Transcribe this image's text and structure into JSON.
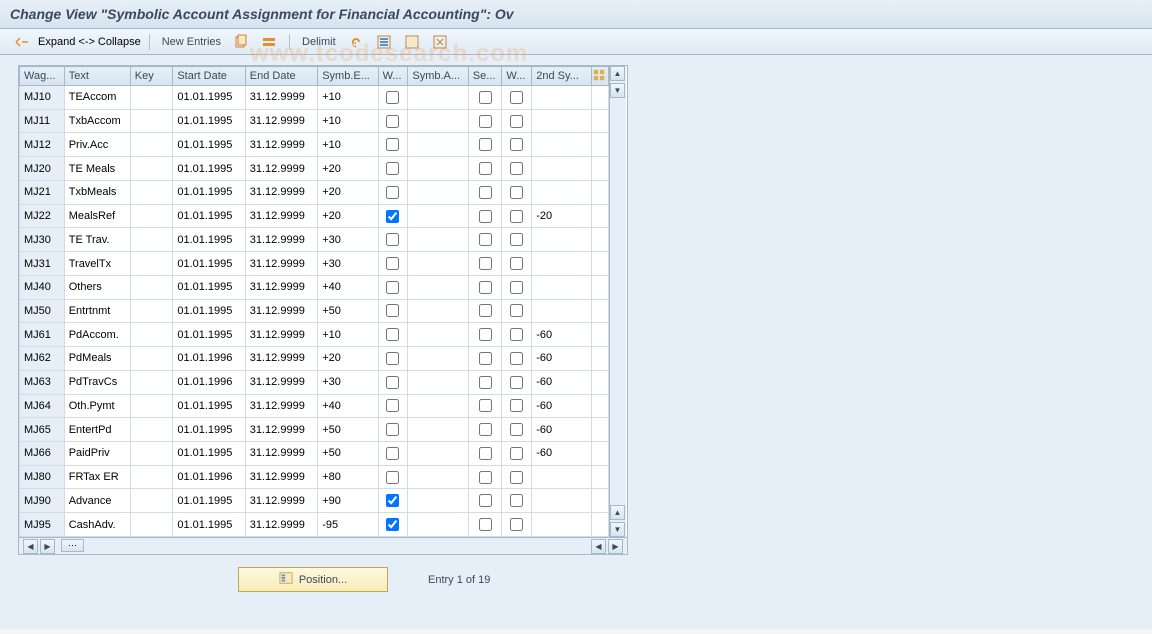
{
  "header": {
    "title": "Change View \"Symbolic Account Assignment for Financial Accounting\": Ov"
  },
  "toolbar": {
    "expand_collapse_label": "Expand <-> Collapse",
    "new_entries_label": "New Entries",
    "delimit_label": "Delimit"
  },
  "table": {
    "headers": {
      "wag": "Wag...",
      "text": "Text",
      "key": "Key",
      "start_date": "Start Date",
      "end_date": "End Date",
      "symb_e": "Symb.E...",
      "w1": "W...",
      "symb_a": "Symb.A...",
      "se": "Se...",
      "w2": "W...",
      "second_sy": "2nd Sy..."
    },
    "rows": [
      {
        "wag": "MJ10",
        "text": "TEAccom",
        "key": "",
        "start": "01.01.1995",
        "end": "31.12.9999",
        "symbe": "+10",
        "w1": false,
        "symba": "",
        "se": false,
        "w2": false,
        "sy2": ""
      },
      {
        "wag": "MJ11",
        "text": "TxbAccom",
        "key": "",
        "start": "01.01.1995",
        "end": "31.12.9999",
        "symbe": "+10",
        "w1": false,
        "symba": "",
        "se": false,
        "w2": false,
        "sy2": ""
      },
      {
        "wag": "MJ12",
        "text": "Priv.Acc",
        "key": "",
        "start": "01.01.1995",
        "end": "31.12.9999",
        "symbe": "+10",
        "w1": false,
        "symba": "",
        "se": false,
        "w2": false,
        "sy2": ""
      },
      {
        "wag": "MJ20",
        "text": "TE Meals",
        "key": "",
        "start": "01.01.1995",
        "end": "31.12.9999",
        "symbe": "+20",
        "w1": false,
        "symba": "",
        "se": false,
        "w2": false,
        "sy2": ""
      },
      {
        "wag": "MJ21",
        "text": "TxbMeals",
        "key": "",
        "start": "01.01.1995",
        "end": "31.12.9999",
        "symbe": "+20",
        "w1": false,
        "symba": "",
        "se": false,
        "w2": false,
        "sy2": ""
      },
      {
        "wag": "MJ22",
        "text": "MealsRef",
        "key": "",
        "start": "01.01.1995",
        "end": "31.12.9999",
        "symbe": "+20",
        "w1": true,
        "symba": "",
        "se": false,
        "w2": false,
        "sy2": "-20"
      },
      {
        "wag": "MJ30",
        "text": "TE Trav.",
        "key": "",
        "start": "01.01.1995",
        "end": "31.12.9999",
        "symbe": "+30",
        "w1": false,
        "symba": "",
        "se": false,
        "w2": false,
        "sy2": ""
      },
      {
        "wag": "MJ31",
        "text": "TravelTx",
        "key": "",
        "start": "01.01.1995",
        "end": "31.12.9999",
        "symbe": "+30",
        "w1": false,
        "symba": "",
        "se": false,
        "w2": false,
        "sy2": ""
      },
      {
        "wag": "MJ40",
        "text": "Others",
        "key": "",
        "start": "01.01.1995",
        "end": "31.12.9999",
        "symbe": "+40",
        "w1": false,
        "symba": "",
        "se": false,
        "w2": false,
        "sy2": ""
      },
      {
        "wag": "MJ50",
        "text": "Entrtnmt",
        "key": "",
        "start": "01.01.1995",
        "end": "31.12.9999",
        "symbe": "+50",
        "w1": false,
        "symba": "",
        "se": false,
        "w2": false,
        "sy2": ""
      },
      {
        "wag": "MJ61",
        "text": "PdAccom.",
        "key": "",
        "start": "01.01.1995",
        "end": "31.12.9999",
        "symbe": "+10",
        "w1": false,
        "symba": "",
        "se": false,
        "w2": false,
        "sy2": "-60"
      },
      {
        "wag": "MJ62",
        "text": "PdMeals",
        "key": "",
        "start": "01.01.1996",
        "end": "31.12.9999",
        "symbe": "+20",
        "w1": false,
        "symba": "",
        "se": false,
        "w2": false,
        "sy2": "-60"
      },
      {
        "wag": "MJ63",
        "text": "PdTravCs",
        "key": "",
        "start": "01.01.1996",
        "end": "31.12.9999",
        "symbe": "+30",
        "w1": false,
        "symba": "",
        "se": false,
        "w2": false,
        "sy2": "-60"
      },
      {
        "wag": "MJ64",
        "text": "Oth.Pymt",
        "key": "",
        "start": "01.01.1995",
        "end": "31.12.9999",
        "symbe": "+40",
        "w1": false,
        "symba": "",
        "se": false,
        "w2": false,
        "sy2": "-60"
      },
      {
        "wag": "MJ65",
        "text": "EntertPd",
        "key": "",
        "start": "01.01.1995",
        "end": "31.12.9999",
        "symbe": "+50",
        "w1": false,
        "symba": "",
        "se": false,
        "w2": false,
        "sy2": "-60"
      },
      {
        "wag": "MJ66",
        "text": "PaidPriv",
        "key": "",
        "start": "01.01.1995",
        "end": "31.12.9999",
        "symbe": "+50",
        "w1": false,
        "symba": "",
        "se": false,
        "w2": false,
        "sy2": "-60"
      },
      {
        "wag": "MJ80",
        "text": "FRTax ER",
        "key": "",
        "start": "01.01.1996",
        "end": "31.12.9999",
        "symbe": "+80",
        "w1": false,
        "symba": "",
        "se": false,
        "w2": false,
        "sy2": ""
      },
      {
        "wag": "MJ90",
        "text": "Advance",
        "key": "",
        "start": "01.01.1995",
        "end": "31.12.9999",
        "symbe": "+90",
        "w1": true,
        "symba": "",
        "se": false,
        "w2": false,
        "sy2": ""
      },
      {
        "wag": "MJ95",
        "text": "CashAdv.",
        "key": "",
        "start": "01.01.1995",
        "end": "31.12.9999",
        "symbe": "-95",
        "w1": true,
        "symba": "",
        "se": false,
        "w2": false,
        "sy2": ""
      }
    ]
  },
  "footer": {
    "position_label": "Position...",
    "entry_count": "Entry 1 of 19"
  }
}
